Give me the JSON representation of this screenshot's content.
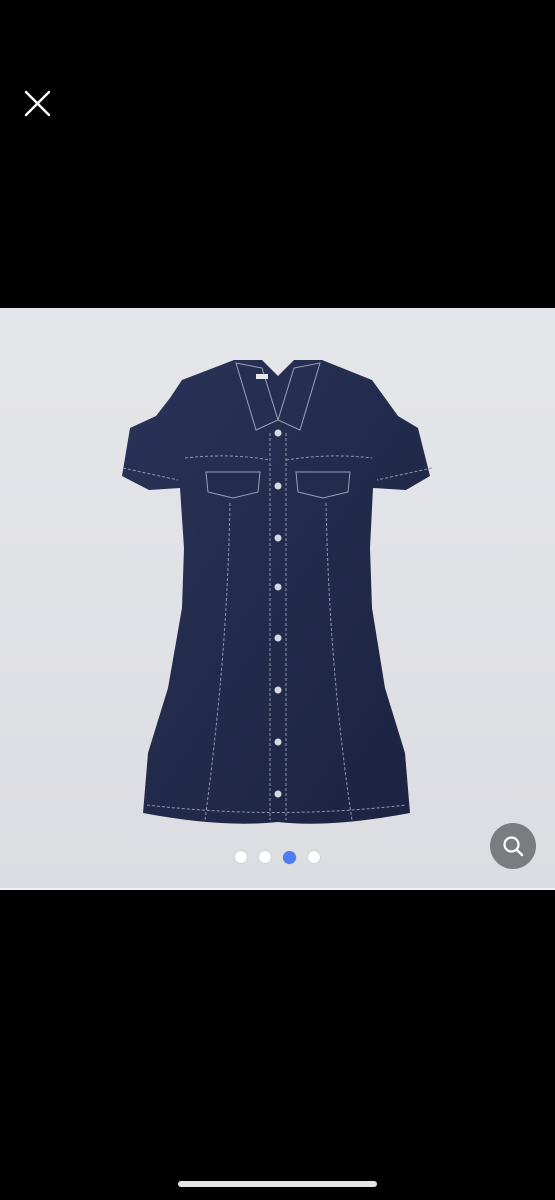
{
  "viewer": {
    "current_image": 3,
    "image_count": 4,
    "indicator_colors": {
      "active": "#4f7cf0",
      "inactive": "#ffffff"
    }
  },
  "controls": {
    "close_icon": "close-icon",
    "zoom_icon": "search-icon"
  },
  "product": {
    "image_description_icon": "denim-dress-photo"
  }
}
